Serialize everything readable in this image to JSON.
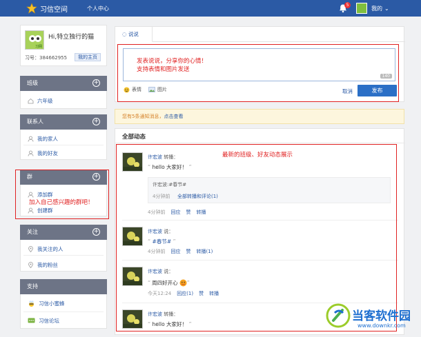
{
  "header": {
    "app_name": "习信空间",
    "nav_personal": "个人中心",
    "notification_count": "5",
    "user_name": "我的"
  },
  "profile": {
    "greeting": "Hi,特立独行的猫",
    "avatar_label": "习网",
    "id_text": "习号：384662955",
    "home_button": "我的主页"
  },
  "sidebar": {
    "class_title": "班级",
    "class_items": [
      "六年级"
    ],
    "contacts_title": "联系人",
    "contacts_items": [
      "我的家人",
      "我的好友"
    ],
    "group_title": "群",
    "group_items": [
      "添加群",
      "创建群"
    ],
    "follow_title": "关注",
    "follow_items": [
      "我关注的人",
      "我的粉丝"
    ],
    "support_title": "支持",
    "support_items": [
      "习信小蜜蜂",
      "习信论坛"
    ]
  },
  "composer": {
    "tab_label": "说说",
    "counter": "140",
    "emoji_label": "表情",
    "image_label": "图片",
    "cancel": "取消",
    "publish": "发布"
  },
  "notice": {
    "text": "您有5条通知消息，",
    "link": "点击查看"
  },
  "feed": {
    "title": "全部动态",
    "posts": [
      {
        "user": "许宏波",
        "action": "转播：",
        "message": "hello 大家好！",
        "share_text": "许宏波:#春节#",
        "share_time": "4分钟前",
        "share_link": "全部转播和评论(1)",
        "time": "4分钟前",
        "reply": "回应",
        "like": "赞",
        "forward": "转播"
      },
      {
        "user": "许宏波",
        "action": "说：",
        "message": "#春节#",
        "time": "4分钟前",
        "reply": "回应",
        "like": "赞",
        "forward": "转播(1)"
      },
      {
        "user": "许宏波",
        "action": "说：",
        "message": "周四好开心",
        "time": "今天12:24",
        "reply": "回应(1)",
        "like": "赞",
        "forward": "转播"
      },
      {
        "user": "许宏波",
        "action": "转播：",
        "message": "hello 大家好！"
      }
    ]
  },
  "annotations": {
    "composer_line1": "发表说说，分享你的心情！",
    "composer_line2": "支持表情和图片发送",
    "group_note": "加入自己感兴趣的群吧！",
    "feed_note": "最新的班级、好友动态展示"
  },
  "watermark": {
    "title": "当客软件园",
    "url": "www.downkr.com"
  },
  "colors": {
    "header_bg": "#2b5aa5",
    "section_bg": "#6d7486",
    "accent": "#2b6fc6",
    "annotation": "#e02020",
    "notice_text": "#d5822a"
  }
}
